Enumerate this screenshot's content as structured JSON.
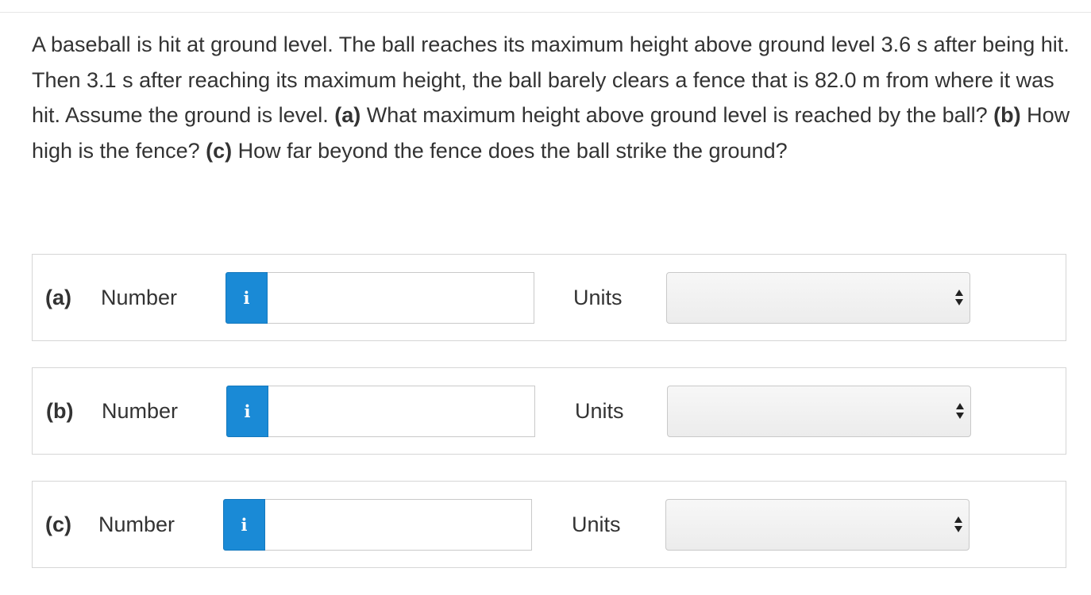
{
  "question": {
    "s1": "A baseball is hit at ground level. The ball reaches its maximum height above ground level 3.6 s after being hit. Then 3.1 s after reaching its maximum height, the ball barely clears a fence that is 82.0 m from where it was hit. Assume the ground is level. ",
    "a_marker": "(a)",
    "a_text": " What maximum height above ground level is reached by the ball? ",
    "b_marker": "(b)",
    "b_text": " How high is the fence? ",
    "c_marker": "(c)",
    "c_text": " How far beyond the fence does the ball strike the ground?"
  },
  "parts": [
    {
      "label": "(a)",
      "number_label": "Number",
      "info_icon": "i",
      "number_value": "",
      "units_label": "Units",
      "units_selected": ""
    },
    {
      "label": "(b)",
      "number_label": "Number",
      "info_icon": "i",
      "number_value": "",
      "units_label": "Units",
      "units_selected": ""
    },
    {
      "label": "(c)",
      "number_label": "Number",
      "info_icon": "i",
      "number_value": "",
      "units_label": "Units",
      "units_selected": ""
    }
  ],
  "icons": {
    "info": "info-icon",
    "select_arrows": "up-down-arrows-icon"
  },
  "colors": {
    "info_button": "#1a8ad6",
    "text": "#333333",
    "border": "#d6d6d6"
  }
}
